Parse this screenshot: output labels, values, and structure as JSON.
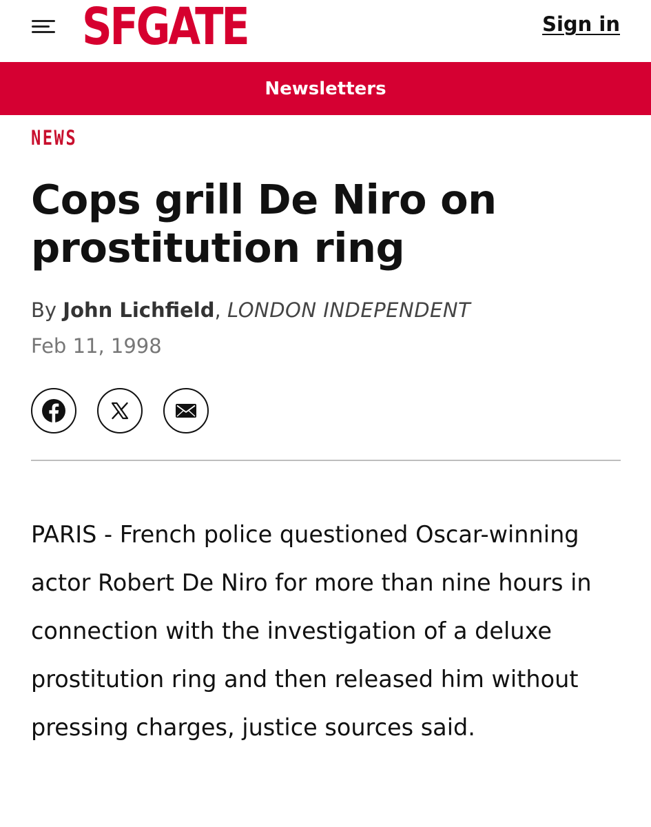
{
  "header": {
    "menu_icon": "hamburger-menu-icon",
    "logo_text": "SFGATE",
    "signin_label": "Sign in",
    "brand_color": "#d6002f"
  },
  "banner": {
    "label": "Newsletters",
    "background_color": "#d50032"
  },
  "article": {
    "section": "NEWS",
    "headline": "Cops grill De Niro on prostitution ring",
    "byline_prefix": "By",
    "author": "John Lichfield",
    "byline_separator": ",",
    "source": "LONDON INDEPENDENT",
    "date": "Feb 11, 1998",
    "share": [
      {
        "icon": "facebook-icon"
      },
      {
        "icon": "x-icon"
      },
      {
        "icon": "email-icon"
      }
    ],
    "body": "PARIS - French police questioned Oscar-winning actor Robert De Niro for more than nine hours in connection with the investigation of a deluxe prostitution ring and then released him without pressing charges, justice sources said."
  }
}
